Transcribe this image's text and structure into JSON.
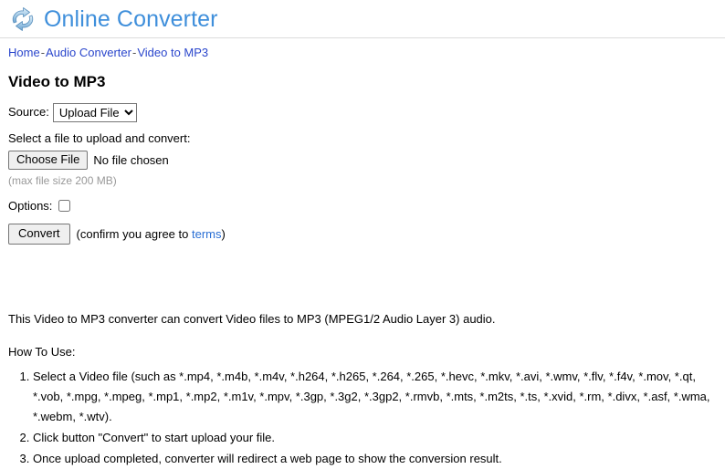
{
  "header": {
    "logo_icon": "refresh-cycle-arrows-icon",
    "brand_title": "Online Converter",
    "brand_color": "#3f8fdb"
  },
  "breadcrumb": {
    "separator": "-",
    "items": [
      {
        "label": "Home"
      },
      {
        "label": "Audio Converter"
      },
      {
        "label": "Video to MP3"
      }
    ],
    "link_color": "#2a46cc"
  },
  "page_title": "Video to MP3",
  "form": {
    "source_label": "Source:",
    "source_selected": "Upload File",
    "source_options": [
      "Upload File"
    ],
    "file_prompt": "Select a file to upload and convert:",
    "choose_file_button": "Choose File",
    "file_status": "No file chosen",
    "max_size_hint": "(max file size 200 MB)",
    "options_label": "Options:",
    "options_checked": false,
    "convert_button": "Convert",
    "convert_note_prefix": "(confirm you agree to ",
    "convert_note_link": "terms",
    "convert_note_suffix": ")"
  },
  "content": {
    "description": "This Video to MP3 converter can convert Video files to MP3 (MPEG1/2 Audio Layer 3) audio.",
    "howto_label": "How To Use:",
    "steps": [
      "Select a Video file (such as *.mp4, *.m4b, *.m4v, *.h264, *.h265, *.264, *.265, *.hevc, *.mkv, *.avi, *.wmv, *.flv, *.f4v, *.mov, *.qt, *.vob, *.mpg, *.mpeg, *.mp1, *.mp2, *.m1v, *.mpv, *.3gp, *.3g2, *.3gp2, *.rmvb, *.mts, *.m2ts, *.ts, *.xvid, *.rm, *.divx, *.asf, *.wma, *.webm, *.wtv).",
      "Click button \"Convert\" to start upload your file.",
      "Once upload completed, converter will redirect a web page to show the conversion result."
    ]
  }
}
